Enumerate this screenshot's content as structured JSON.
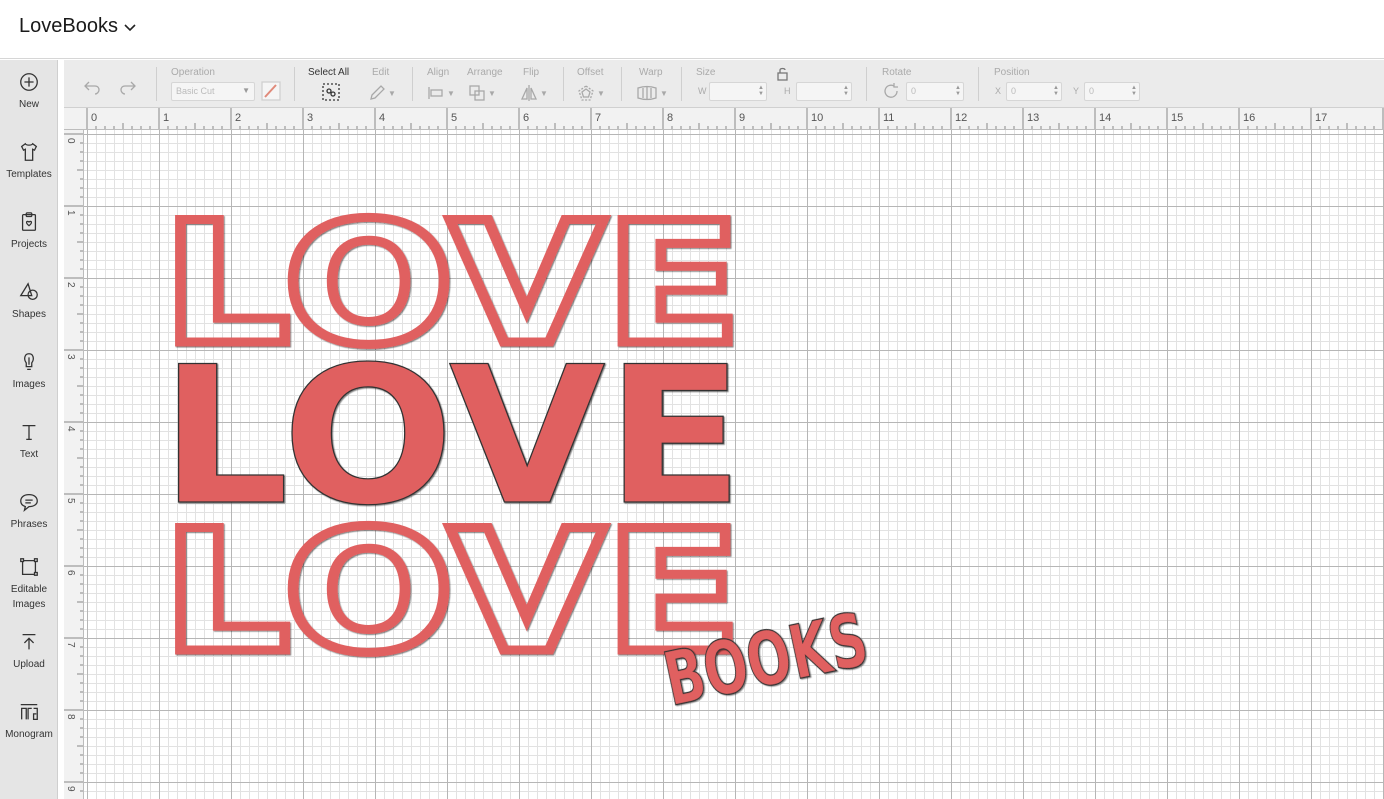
{
  "header": {
    "project_title": "LoveBooks"
  },
  "sidebar": {
    "items": [
      {
        "label": "New",
        "icon": "plus-circle-icon"
      },
      {
        "label": "Templates",
        "icon": "tshirt-icon"
      },
      {
        "label": "Projects",
        "icon": "clipboard-heart-icon"
      },
      {
        "label": "Shapes",
        "icon": "shapes-icon"
      },
      {
        "label": "Images",
        "icon": "lightbulb-icon"
      },
      {
        "label": "Text",
        "icon": "text-t-icon"
      },
      {
        "label": "Phrases",
        "icon": "speech-bubble-icon"
      },
      {
        "label": "Editable Images",
        "icon": "node-edit-icon"
      },
      {
        "label": "Upload",
        "icon": "upload-arrow-icon"
      },
      {
        "label": "Monogram",
        "icon": "monogram-icon"
      }
    ]
  },
  "toolbar": {
    "operation_label": "Operation",
    "operation_value": "Basic Cut",
    "select_all_label": "Select All",
    "edit_label": "Edit",
    "align_label": "Align",
    "arrange_label": "Arrange",
    "flip_label": "Flip",
    "offset_label": "Offset",
    "warp_label": "Warp",
    "size_label": "Size",
    "size_w_label": "W",
    "size_h_label": "H",
    "rotate_label": "Rotate",
    "rotate_value": "0",
    "position_label": "Position",
    "position_x_label": "X",
    "position_x_value": "0",
    "position_y_label": "Y",
    "position_y_value": "0"
  },
  "ruler": {
    "top": [
      "0",
      "1",
      "2",
      "3",
      "4",
      "5",
      "6",
      "7",
      "8",
      "9",
      "10",
      "11",
      "12",
      "13",
      "14",
      "15",
      "16",
      "17"
    ],
    "left": [
      "0",
      "1",
      "2",
      "3",
      "4",
      "5",
      "6",
      "7",
      "8",
      "9"
    ]
  },
  "design": {
    "words": [
      "LOVE",
      "LOVE",
      "LOVE",
      "BOOKS"
    ],
    "fill_color": "#e06060",
    "stroke_color": "#333333"
  }
}
